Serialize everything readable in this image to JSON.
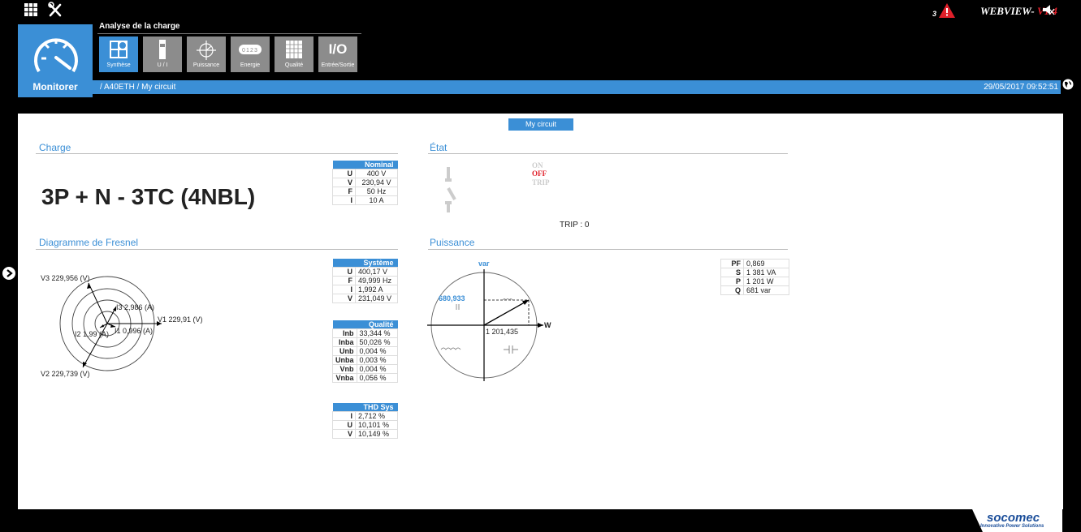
{
  "header": {
    "menu_title": "Analyse de la charge",
    "monitor_label": "Monitorer",
    "menu_items": [
      {
        "label": "Synthèse",
        "icon": "synthesis-icon"
      },
      {
        "label": "U / I",
        "icon": "ui-icon"
      },
      {
        "label": "Puissance",
        "icon": "power-icon"
      },
      {
        "label": "Energie",
        "icon": "energy-counter-icon"
      },
      {
        "label": "Qualité",
        "icon": "quality-icon"
      },
      {
        "label": "Entrée/Sortie",
        "icon_text": "I/O"
      }
    ],
    "breadcrumb": "/ A40ETH / My circuit",
    "datetime": "29/05/2017 09:52:51",
    "alarm_count": "3",
    "app_name": "WEBVIEW-",
    "version": "V1.4",
    "accent_color": "#3b8fd6",
    "alarm_color": "#e0202a"
  },
  "main": {
    "circuit_tab": "My circuit",
    "charge": {
      "title": "Charge",
      "config": "3P + N - 3TC (4NBL)",
      "nominal": {
        "header": "Nominal",
        "rows": [
          {
            "k": "U",
            "v": "400 V"
          },
          {
            "k": "V",
            "v": "230,94 V"
          },
          {
            "k": "F",
            "v": "50 Hz"
          },
          {
            "k": "I",
            "v": "10 A"
          }
        ]
      }
    },
    "etat": {
      "title": "État",
      "on": "ON",
      "off": "OFF",
      "trip": "TRIP",
      "trip_count": "TRIP : 0"
    },
    "fresnel": {
      "title": "Diagramme de Fresnel",
      "v3": "V3  229,956  (V)",
      "i3": "I3  2,986  (A)",
      "v1": "V1  229,91  (V)",
      "i2": "I2  1,99  (A)",
      "i1": "I1  0,996  (A)",
      "v2": "V2  229,739  (V)",
      "systeme": {
        "header": "Système",
        "rows": [
          {
            "k": "U",
            "v": "400,17 V"
          },
          {
            "k": "F",
            "v": "49,999 Hz"
          },
          {
            "k": "I",
            "v": "1,992 A"
          },
          {
            "k": "V",
            "v": "231,049 V"
          }
        ]
      },
      "qualite": {
        "header": "Qualité",
        "rows": [
          {
            "k": "Inb",
            "v": "33,344 %"
          },
          {
            "k": "Inba",
            "v": "50,026 %"
          },
          {
            "k": "Unb",
            "v": "0,004 %"
          },
          {
            "k": "Unba",
            "v": "0,003 %"
          },
          {
            "k": "Vnb",
            "v": "0,004 %"
          },
          {
            "k": "Vnba",
            "v": "0,056 %"
          }
        ]
      },
      "thd": {
        "header": "THD Sys",
        "rows": [
          {
            "k": "I",
            "v": "2,712 %"
          },
          {
            "k": "U",
            "v": "10,101 %"
          },
          {
            "k": "V",
            "v": "10,149 %"
          }
        ]
      }
    },
    "puissance": {
      "title": "Puissance",
      "var_label": "var",
      "w_label": "W",
      "q_value": "680,933",
      "p_value": "1 201,435",
      "table": {
        "rows": [
          {
            "k": "PF",
            "v": "0,869"
          },
          {
            "k": "S",
            "v": "1 381 VA"
          },
          {
            "k": "P",
            "v": "1 201 W"
          },
          {
            "k": "Q",
            "v": "681 var"
          }
        ]
      }
    }
  },
  "footer": {
    "brand": "socomec",
    "tagline": "Innovative Power Solutions"
  }
}
